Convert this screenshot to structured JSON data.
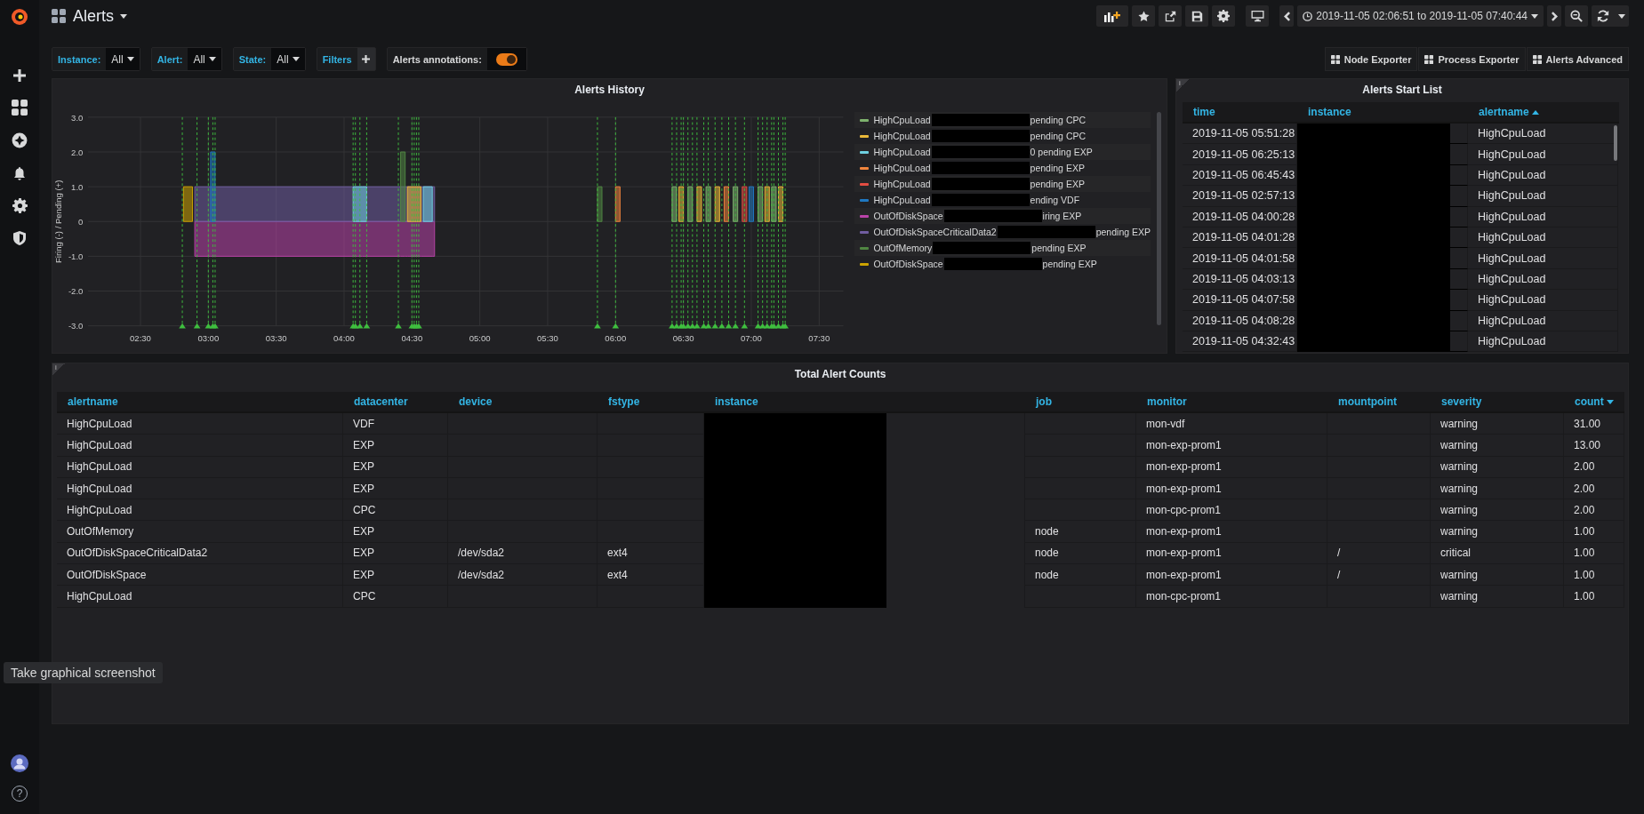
{
  "sidebar": {
    "help": "?"
  },
  "dashboard": {
    "title": "Alerts"
  },
  "toolbar": {
    "time_range": "2019-11-05 02:06:51 to 2019-11-05 07:40:44"
  },
  "variables": [
    {
      "label": "Instance:",
      "value": "All"
    },
    {
      "label": "Alert:",
      "value": "All"
    },
    {
      "label": "State:",
      "value": "All"
    }
  ],
  "filters": {
    "label": "Filters"
  },
  "annotation_toggle": {
    "label": "Alerts annotations:",
    "on": true
  },
  "links": [
    "Node Exporter",
    "Process Exporter",
    "Alerts Advanced"
  ],
  "history": {
    "title": "Alerts History",
    "chart_data": {
      "type": "area",
      "ylabel": "Firing (-) / Pending (+)",
      "x": [
        169,
        173,
        174,
        181,
        183,
        244,
        246,
        248,
        250,
        265,
        267,
        268,
        274,
        275,
        279,
        280,
        352,
        354,
        360,
        362,
        385,
        387,
        388,
        390,
        392,
        394,
        396,
        398,
        400,
        402,
        404,
        406,
        408,
        410,
        412,
        414,
        416,
        418,
        419,
        421,
        423,
        425,
        426,
        428,
        429,
        431,
        432,
        434
      ],
      "xlim": [
        126.85,
        460.7
      ],
      "ylim": [
        -3,
        3
      ],
      "xticks": [
        {
          "value": 150,
          "label": "02:30"
        },
        {
          "value": 180,
          "label": "03:00"
        },
        {
          "value": 210,
          "label": "03:30"
        },
        {
          "value": 240,
          "label": "04:00"
        },
        {
          "value": 270,
          "label": "04:30"
        },
        {
          "value": 300,
          "label": "05:00"
        },
        {
          "value": 330,
          "label": "05:30"
        },
        {
          "value": 360,
          "label": "06:00"
        },
        {
          "value": 390,
          "label": "06:30"
        },
        {
          "value": 420,
          "label": "07:00"
        },
        {
          "value": 450,
          "label": "07:30"
        }
      ],
      "yticks": [
        {
          "value": 3,
          "label": "3.0"
        },
        {
          "value": 2,
          "label": "2.0"
        },
        {
          "value": 1,
          "label": "1.0"
        },
        {
          "value": 0,
          "label": "0"
        },
        {
          "value": -1,
          "label": "-1.0"
        },
        {
          "value": -2,
          "label": "-2.0"
        },
        {
          "value": -3,
          "label": "-3.0"
        }
      ],
      "series": [
        {
          "name": "HighCpuLoad",
          "color": "#7eb26d",
          "values": [
            null,
            null,
            null,
            null,
            null,
            null,
            null,
            null,
            null,
            null,
            null,
            null,
            null,
            null,
            null,
            null,
            null,
            null,
            null,
            null,
            1,
            1,
            null,
            null,
            1,
            1,
            null,
            null,
            1,
            1,
            null,
            null,
            null,
            null,
            1,
            1,
            null,
            null,
            null,
            null,
            1,
            1,
            null,
            null,
            1,
            1,
            null,
            null
          ]
        },
        {
          "name": "HighCpuLoad",
          "color": "#eab839",
          "values": [
            null,
            null,
            null,
            null,
            null,
            null,
            null,
            null,
            null,
            null,
            null,
            1,
            1,
            null,
            null,
            null,
            null,
            null,
            null,
            null,
            null,
            null,
            1,
            1,
            null,
            null,
            1,
            1,
            null,
            null,
            1,
            1,
            null,
            null,
            null,
            null,
            null,
            null,
            null,
            null,
            null,
            null,
            1,
            1,
            null,
            null,
            1,
            1
          ]
        },
        {
          "name": "HighCpuLoad",
          "color": "#6ed0e0",
          "values": [
            null,
            null,
            null,
            null,
            null,
            1,
            1,
            1,
            1,
            null,
            null,
            null,
            null,
            1,
            1,
            null,
            null,
            null,
            null,
            null,
            null,
            null,
            null,
            null,
            null,
            null,
            null,
            null,
            null,
            null,
            null,
            null,
            null,
            null,
            null,
            null,
            null,
            null,
            null,
            null,
            null,
            null,
            null,
            null,
            null,
            null,
            null,
            null
          ]
        },
        {
          "name": "HighCpuLoad",
          "color": "#ef843c",
          "values": [
            null,
            null,
            null,
            null,
            null,
            null,
            null,
            null,
            null,
            null,
            null,
            null,
            null,
            null,
            null,
            null,
            null,
            null,
            1,
            1,
            null,
            null,
            null,
            null,
            null,
            null,
            null,
            null,
            null,
            null,
            null,
            null,
            1,
            1,
            null,
            null,
            null,
            null,
            null,
            null,
            null,
            null,
            null,
            null,
            null,
            null,
            null,
            null
          ]
        },
        {
          "name": "HighCpuLoad",
          "color": "#e24d42",
          "values": [
            null,
            null,
            null,
            null,
            null,
            null,
            null,
            null,
            null,
            null,
            null,
            null,
            null,
            null,
            null,
            null,
            null,
            null,
            null,
            null,
            null,
            null,
            null,
            null,
            null,
            null,
            null,
            null,
            null,
            null,
            null,
            null,
            null,
            null,
            null,
            null,
            1,
            1,
            null,
            null,
            null,
            null,
            null,
            null,
            null,
            null,
            null,
            null
          ]
        },
        {
          "name": "HighCpuLoad",
          "color": "#1f78c1",
          "values": [
            null,
            null,
            null,
            2,
            2,
            null,
            null,
            null,
            null,
            null,
            null,
            null,
            null,
            null,
            null,
            null,
            null,
            null,
            null,
            null,
            null,
            null,
            null,
            null,
            null,
            null,
            null,
            null,
            null,
            null,
            null,
            null,
            null,
            null,
            null,
            null,
            null,
            null,
            1,
            1,
            null,
            null,
            null,
            null,
            null,
            null,
            null,
            null
          ]
        },
        {
          "name": "OutOfDiskSpace",
          "color": "#ba43a9",
          "values": [
            null,
            null,
            -1,
            -1,
            -1,
            -1,
            -1,
            -1,
            -1,
            -1,
            -1,
            -1,
            -1,
            -1,
            -1,
            -1,
            null,
            null,
            null,
            null,
            null,
            null,
            null,
            null,
            null,
            null,
            null,
            null,
            null,
            null,
            null,
            null,
            null,
            null,
            null,
            null,
            null,
            null,
            null,
            null,
            null,
            null,
            null,
            null,
            null,
            null,
            null,
            null
          ]
        },
        {
          "name": "OutOfDiskSpaceCriticalData2",
          "color": "#705da0",
          "values": [
            null,
            null,
            1,
            1,
            1,
            1,
            1,
            1,
            1,
            1,
            1,
            1,
            1,
            1,
            1,
            1,
            null,
            null,
            null,
            null,
            null,
            null,
            null,
            null,
            null,
            null,
            null,
            null,
            null,
            null,
            null,
            null,
            null,
            null,
            null,
            null,
            null,
            null,
            null,
            null,
            null,
            null,
            null,
            null,
            null,
            null,
            null,
            null
          ]
        },
        {
          "name": "OutOfMemory",
          "color": "#508642",
          "values": [
            null,
            null,
            null,
            null,
            null,
            null,
            null,
            null,
            null,
            2,
            2,
            null,
            null,
            null,
            null,
            null,
            1,
            1,
            null,
            null,
            null,
            null,
            null,
            null,
            null,
            null,
            null,
            null,
            null,
            null,
            null,
            null,
            null,
            null,
            null,
            null,
            null,
            null,
            null,
            null,
            null,
            null,
            null,
            null,
            null,
            null,
            null,
            null
          ]
        },
        {
          "name": "OutOfDiskSpace",
          "color": "#cca300",
          "values": [
            1,
            1,
            null,
            null,
            null,
            null,
            null,
            null,
            null,
            null,
            null,
            null,
            null,
            null,
            null,
            null,
            null,
            null,
            null,
            null,
            null,
            null,
            null,
            null,
            null,
            null,
            null,
            null,
            null,
            null,
            null,
            null,
            null,
            null,
            null,
            null,
            null,
            null,
            null,
            null,
            null,
            null,
            null,
            null,
            null,
            null,
            null,
            null
          ]
        }
      ],
      "grid": true
    },
    "legend": [
      {
        "status": "pending CPC"
      },
      {
        "status": "pending CPC"
      },
      {
        "status": "0 pending EXP"
      },
      {
        "status": "pending EXP"
      },
      {
        "status": "pending EXP"
      },
      {
        "status": "ending VDF"
      },
      {
        "status": "iring EXP"
      },
      {
        "status": "pending EXP"
      },
      {
        "status": "pending EXP"
      },
      {
        "status": "pending EXP"
      }
    ]
  },
  "start_list": {
    "info": "i",
    "title": "Alerts Start List",
    "columns": [
      {
        "label": "time",
        "sorted": false,
        "redacted": false
      },
      {
        "label": "instance",
        "sorted": false,
        "redacted": true
      },
      {
        "label": "alertname",
        "sorted": true,
        "descending": false,
        "redacted": false
      }
    ],
    "rows": [
      [
        "2019-11-05 05:51:28",
        null,
        "HighCpuLoad"
      ],
      [
        "2019-11-05 06:25:13",
        null,
        "HighCpuLoad"
      ],
      [
        "2019-11-05 06:45:43",
        null,
        "HighCpuLoad"
      ],
      [
        "2019-11-05 02:57:13",
        null,
        "HighCpuLoad"
      ],
      [
        "2019-11-05 04:00:28",
        null,
        "HighCpuLoad"
      ],
      [
        "2019-11-05 04:01:28",
        null,
        "HighCpuLoad"
      ],
      [
        "2019-11-05 04:01:58",
        null,
        "HighCpuLoad"
      ],
      [
        "2019-11-05 04:03:13",
        null,
        "HighCpuLoad"
      ],
      [
        "2019-11-05 04:07:58",
        null,
        "HighCpuLoad"
      ],
      [
        "2019-11-05 04:08:28",
        null,
        "HighCpuLoad"
      ],
      [
        "2019-11-05 04:32:43",
        null,
        "HighCpuLoad"
      ]
    ]
  },
  "counts": {
    "info": "i",
    "title": "Total Alert Counts",
    "columns": [
      {
        "label": "alertname",
        "sorted": false,
        "redacted": false
      },
      {
        "label": "datacenter",
        "sorted": false,
        "redacted": false
      },
      {
        "label": "device",
        "sorted": false,
        "redacted": false
      },
      {
        "label": "fstype",
        "sorted": false,
        "redacted": false
      },
      {
        "label": "instance",
        "sorted": false,
        "redacted": true
      },
      {
        "label": "job",
        "sorted": false,
        "redacted": false
      },
      {
        "label": "monitor",
        "sorted": false,
        "redacted": false
      },
      {
        "label": "mountpoint",
        "sorted": false,
        "redacted": false
      },
      {
        "label": "severity",
        "sorted": false,
        "redacted": false
      },
      {
        "label": "count",
        "sorted": true,
        "descending": true,
        "redacted": false
      }
    ],
    "rows": [
      [
        "HighCpuLoad",
        "VDF",
        null,
        null,
        null,
        null,
        "mon-vdf",
        null,
        "warning",
        "31.00"
      ],
      [
        "HighCpuLoad",
        "EXP",
        null,
        null,
        null,
        null,
        "mon-exp-prom1",
        null,
        "warning",
        "13.00"
      ],
      [
        "HighCpuLoad",
        "EXP",
        null,
        null,
        null,
        null,
        "mon-exp-prom1",
        null,
        "warning",
        "2.00"
      ],
      [
        "HighCpuLoad",
        "EXP",
        null,
        null,
        null,
        null,
        "mon-exp-prom1",
        null,
        "warning",
        "2.00"
      ],
      [
        "HighCpuLoad",
        "CPC",
        null,
        null,
        null,
        null,
        "mon-cpc-prom1",
        null,
        "warning",
        "2.00"
      ],
      [
        "OutOfMemory",
        "EXP",
        null,
        null,
        null,
        "node",
        "mon-exp-prom1",
        null,
        "warning",
        "1.00"
      ],
      [
        "OutOfDiskSpaceCriticalData2",
        "EXP",
        "/dev/sda2",
        "ext4",
        null,
        "node",
        "mon-exp-prom1",
        "/",
        "critical",
        "1.00"
      ],
      [
        "OutOfDiskSpace",
        "EXP",
        "/dev/sda2",
        "ext4",
        null,
        "node",
        "mon-exp-prom1",
        "/",
        "warning",
        "1.00"
      ],
      [
        "HighCpuLoad",
        "CPC",
        null,
        null,
        null,
        null,
        "mon-cpc-prom1",
        null,
        "warning",
        "1.00"
      ]
    ]
  },
  "tooltip": {
    "text": "Take graphical screenshot"
  }
}
